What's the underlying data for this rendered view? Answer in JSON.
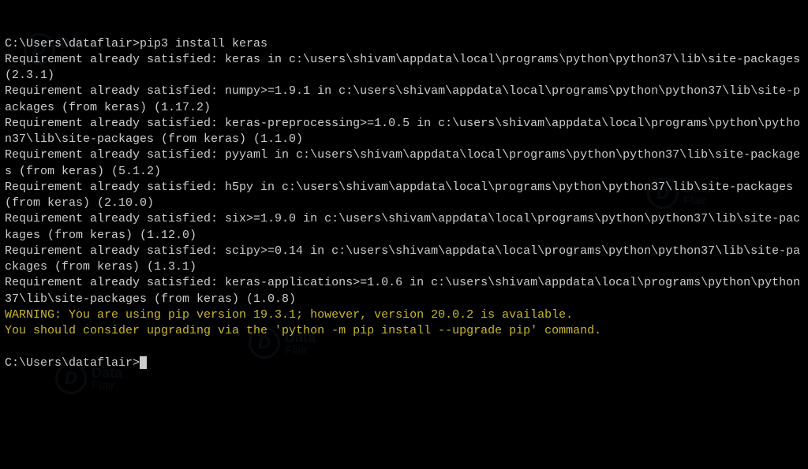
{
  "terminal": {
    "prompt": "C:\\Users\\dataflair>",
    "command": "pip3 install keras",
    "lines": [
      {
        "type": "normal",
        "text": "Requirement already satisfied: keras in c:\\users\\shivam\\appdata\\local\\programs\\python\\python37\\lib\\site-packages (2.3.1)"
      },
      {
        "type": "normal",
        "text": "Requirement already satisfied: numpy>=1.9.1 in c:\\users\\shivam\\appdata\\local\\programs\\python\\python37\\lib\\site-packages (from keras) (1.17.2)"
      },
      {
        "type": "normal",
        "text": "Requirement already satisfied: keras-preprocessing>=1.0.5 in c:\\users\\shivam\\appdata\\local\\programs\\python\\python37\\lib\\site-packages (from keras) (1.1.0)"
      },
      {
        "type": "normal",
        "text": "Requirement already satisfied: pyyaml in c:\\users\\shivam\\appdata\\local\\programs\\python\\python37\\lib\\site-packages (from keras) (5.1.2)"
      },
      {
        "type": "normal",
        "text": "Requirement already satisfied: h5py in c:\\users\\shivam\\appdata\\local\\programs\\python\\python37\\lib\\site-packages (from keras) (2.10.0)"
      },
      {
        "type": "normal",
        "text": "Requirement already satisfied: six>=1.9.0 in c:\\users\\shivam\\appdata\\local\\programs\\python\\python37\\lib\\site-packages (from keras) (1.12.0)"
      },
      {
        "type": "normal",
        "text": "Requirement already satisfied: scipy>=0.14 in c:\\users\\shivam\\appdata\\local\\programs\\python\\python37\\lib\\site-packages (from keras) (1.3.1)"
      },
      {
        "type": "normal",
        "text": "Requirement already satisfied: keras-applications>=1.0.6 in c:\\users\\shivam\\appdata\\local\\programs\\python\\python37\\lib\\site-packages (from keras) (1.0.8)"
      },
      {
        "type": "warning",
        "text": "WARNING: You are using pip version 19.3.1; however, version 20.0.2 is available."
      },
      {
        "type": "warning",
        "text": "You should consider upgrading via the 'python -m pip install --upgrade pip' command."
      }
    ],
    "final_prompt": "C:\\Users\\dataflair>"
  },
  "watermark": {
    "line1": "Data",
    "line2": "Flair",
    "icon": "D"
  }
}
